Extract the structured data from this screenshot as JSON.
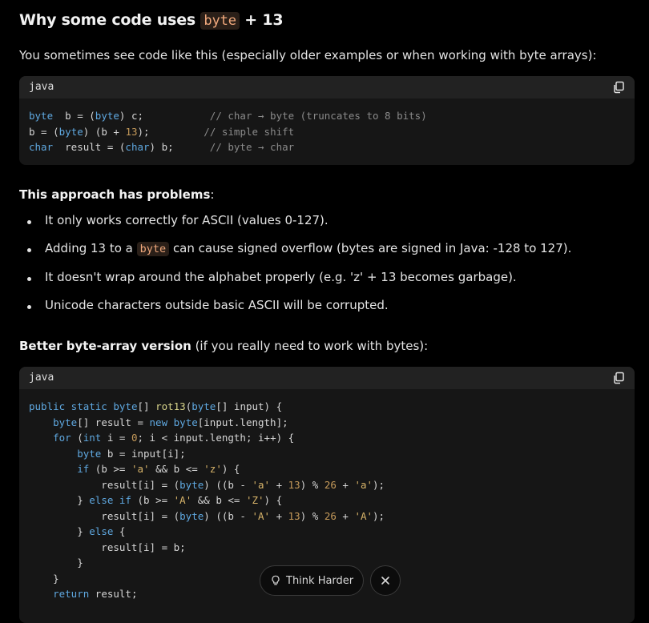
{
  "heading": {
    "pre": "Why some code uses ",
    "code": "byte",
    "post": " + 13"
  },
  "intro": "You sometimes see code like this (especially older examples or when working with byte arrays):",
  "block1": {
    "lang": "java",
    "lines": [
      [
        [
          "kw",
          "byte"
        ],
        [
          "",
          "  b = ("
        ],
        [
          "kw",
          "byte"
        ],
        [
          "",
          ") c;           "
        ],
        [
          "cm",
          "// char → byte (truncates to 8 bits)"
        ]
      ],
      [
        [
          "",
          "b = ("
        ],
        [
          "kw",
          "byte"
        ],
        [
          "",
          ") (b + "
        ],
        [
          "nm",
          "13"
        ],
        [
          "",
          ");         "
        ],
        [
          "cm",
          "// simple shift"
        ]
      ],
      [
        [
          "kw",
          "char"
        ],
        [
          "",
          "  result = ("
        ],
        [
          "kw",
          "char"
        ],
        [
          "",
          ") b;      "
        ],
        [
          "cm",
          "// byte → char"
        ]
      ]
    ]
  },
  "problems": {
    "bold": "This approach has problems",
    "rest": ":"
  },
  "bullets": [
    {
      "text": "It only works correctly for ASCII (values 0-127)."
    },
    {
      "pre": "Adding 13 to a ",
      "code": "byte",
      "post": " can cause signed overflow (bytes are signed in Java: -128 to 127)."
    },
    {
      "text": "It doesn't wrap around the alphabet properly (e.g. 'z' + 13 becomes garbage)."
    },
    {
      "text": "Unicode characters outside basic ASCII will be corrupted."
    }
  ],
  "better": {
    "bold": "Better byte-array version",
    "rest": " (if you really need to work with bytes):"
  },
  "block2": {
    "lang": "java",
    "lines": [
      [
        [
          "kw",
          "public"
        ],
        [
          "",
          ""
        ],
        [
          "kw",
          " static"
        ],
        [
          "",
          " "
        ],
        [
          "kw",
          "byte"
        ],
        [
          "",
          "[] "
        ],
        [
          "fn",
          "rot13"
        ],
        [
          "",
          "("
        ],
        [
          "kw",
          "byte"
        ],
        [
          "",
          "[] input) {"
        ]
      ],
      [
        [
          "",
          "    "
        ],
        [
          "kw",
          "byte"
        ],
        [
          "",
          "[] result = "
        ],
        [
          "kw",
          "new"
        ],
        [
          "",
          " "
        ],
        [
          "kw",
          "byte"
        ],
        [
          "",
          "[input.length];"
        ]
      ],
      [
        [
          "",
          "    "
        ],
        [
          "kw",
          "for"
        ],
        [
          "",
          " ("
        ],
        [
          "kw",
          "int"
        ],
        [
          "",
          " i = "
        ],
        [
          "nm",
          "0"
        ],
        [
          "",
          "; i < input.length; i++) {"
        ]
      ],
      [
        [
          "",
          "        "
        ],
        [
          "kw",
          "byte"
        ],
        [
          "",
          " b = input[i];"
        ]
      ],
      [
        [
          "",
          "        "
        ],
        [
          "kw",
          "if"
        ],
        [
          "",
          " (b >= "
        ],
        [
          "st",
          "'a'"
        ],
        [
          "",
          " && b <= "
        ],
        [
          "st",
          "'z'"
        ],
        [
          "",
          ") {"
        ]
      ],
      [
        [
          "",
          "            result[i] = ("
        ],
        [
          "kw",
          "byte"
        ],
        [
          "",
          ") ((b - "
        ],
        [
          "st",
          "'a'"
        ],
        [
          "",
          " + "
        ],
        [
          "nm",
          "13"
        ],
        [
          "",
          ") % "
        ],
        [
          "nm",
          "26"
        ],
        [
          "",
          " + "
        ],
        [
          "st",
          "'a'"
        ],
        [
          "",
          ");"
        ]
      ],
      [
        [
          "",
          "        } "
        ],
        [
          "kw",
          "else"
        ],
        [
          "",
          " "
        ],
        [
          "kw",
          "if"
        ],
        [
          "",
          " (b >= "
        ],
        [
          "st",
          "'A'"
        ],
        [
          "",
          " && b <= "
        ],
        [
          "st",
          "'Z'"
        ],
        [
          "",
          ") {"
        ]
      ],
      [
        [
          "",
          "            result[i] = ("
        ],
        [
          "kw",
          "byte"
        ],
        [
          "",
          ") ((b - "
        ],
        [
          "st",
          "'A'"
        ],
        [
          "",
          " + "
        ],
        [
          "nm",
          "13"
        ],
        [
          "",
          ") % "
        ],
        [
          "nm",
          "26"
        ],
        [
          "",
          " + "
        ],
        [
          "st",
          "'A'"
        ],
        [
          "",
          ");"
        ]
      ],
      [
        [
          "",
          "        } "
        ],
        [
          "kw",
          "else"
        ],
        [
          "",
          " {"
        ]
      ],
      [
        [
          "",
          "            result[i] = b;"
        ]
      ],
      [
        [
          "",
          "        }"
        ]
      ],
      [
        [
          "",
          "    }"
        ]
      ],
      [
        [
          "",
          "    "
        ],
        [
          "kw",
          "return"
        ],
        [
          "",
          " result;"
        ]
      ]
    ]
  },
  "float_bar": {
    "think_label": "Think Harder"
  },
  "icons": {
    "copy": "copy-icon",
    "bulb": "lightbulb-icon",
    "close": "close-icon"
  }
}
